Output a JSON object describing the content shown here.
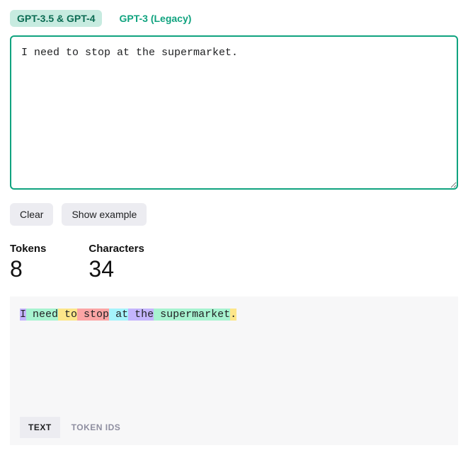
{
  "tabs": {
    "active": "GPT-3.5 & GPT-4",
    "inactive": "GPT-3 (Legacy)"
  },
  "input": {
    "value": "I need to stop at the supermarket."
  },
  "buttons": {
    "clear": "Clear",
    "example": "Show example"
  },
  "stats": {
    "tokens_label": "Tokens",
    "tokens_value": "8",
    "chars_label": "Characters",
    "chars_value": "34"
  },
  "tokens": [
    {
      "text": "I",
      "color": "#c4b5fd"
    },
    {
      "text": " need",
      "color": "#a7f3d0"
    },
    {
      "text": " to",
      "color": "#fde68a"
    },
    {
      "text": " stop",
      "color": "#fca5a5"
    },
    {
      "text": " at",
      "color": "#a5f3fc"
    },
    {
      "text": " the",
      "color": "#c4b5fd"
    },
    {
      "text": " supermarket",
      "color": "#a7f3d0"
    },
    {
      "text": ".",
      "color": "#fde68a"
    }
  ],
  "viz_tabs": {
    "text": "TEXT",
    "ids": "TOKEN IDS"
  }
}
